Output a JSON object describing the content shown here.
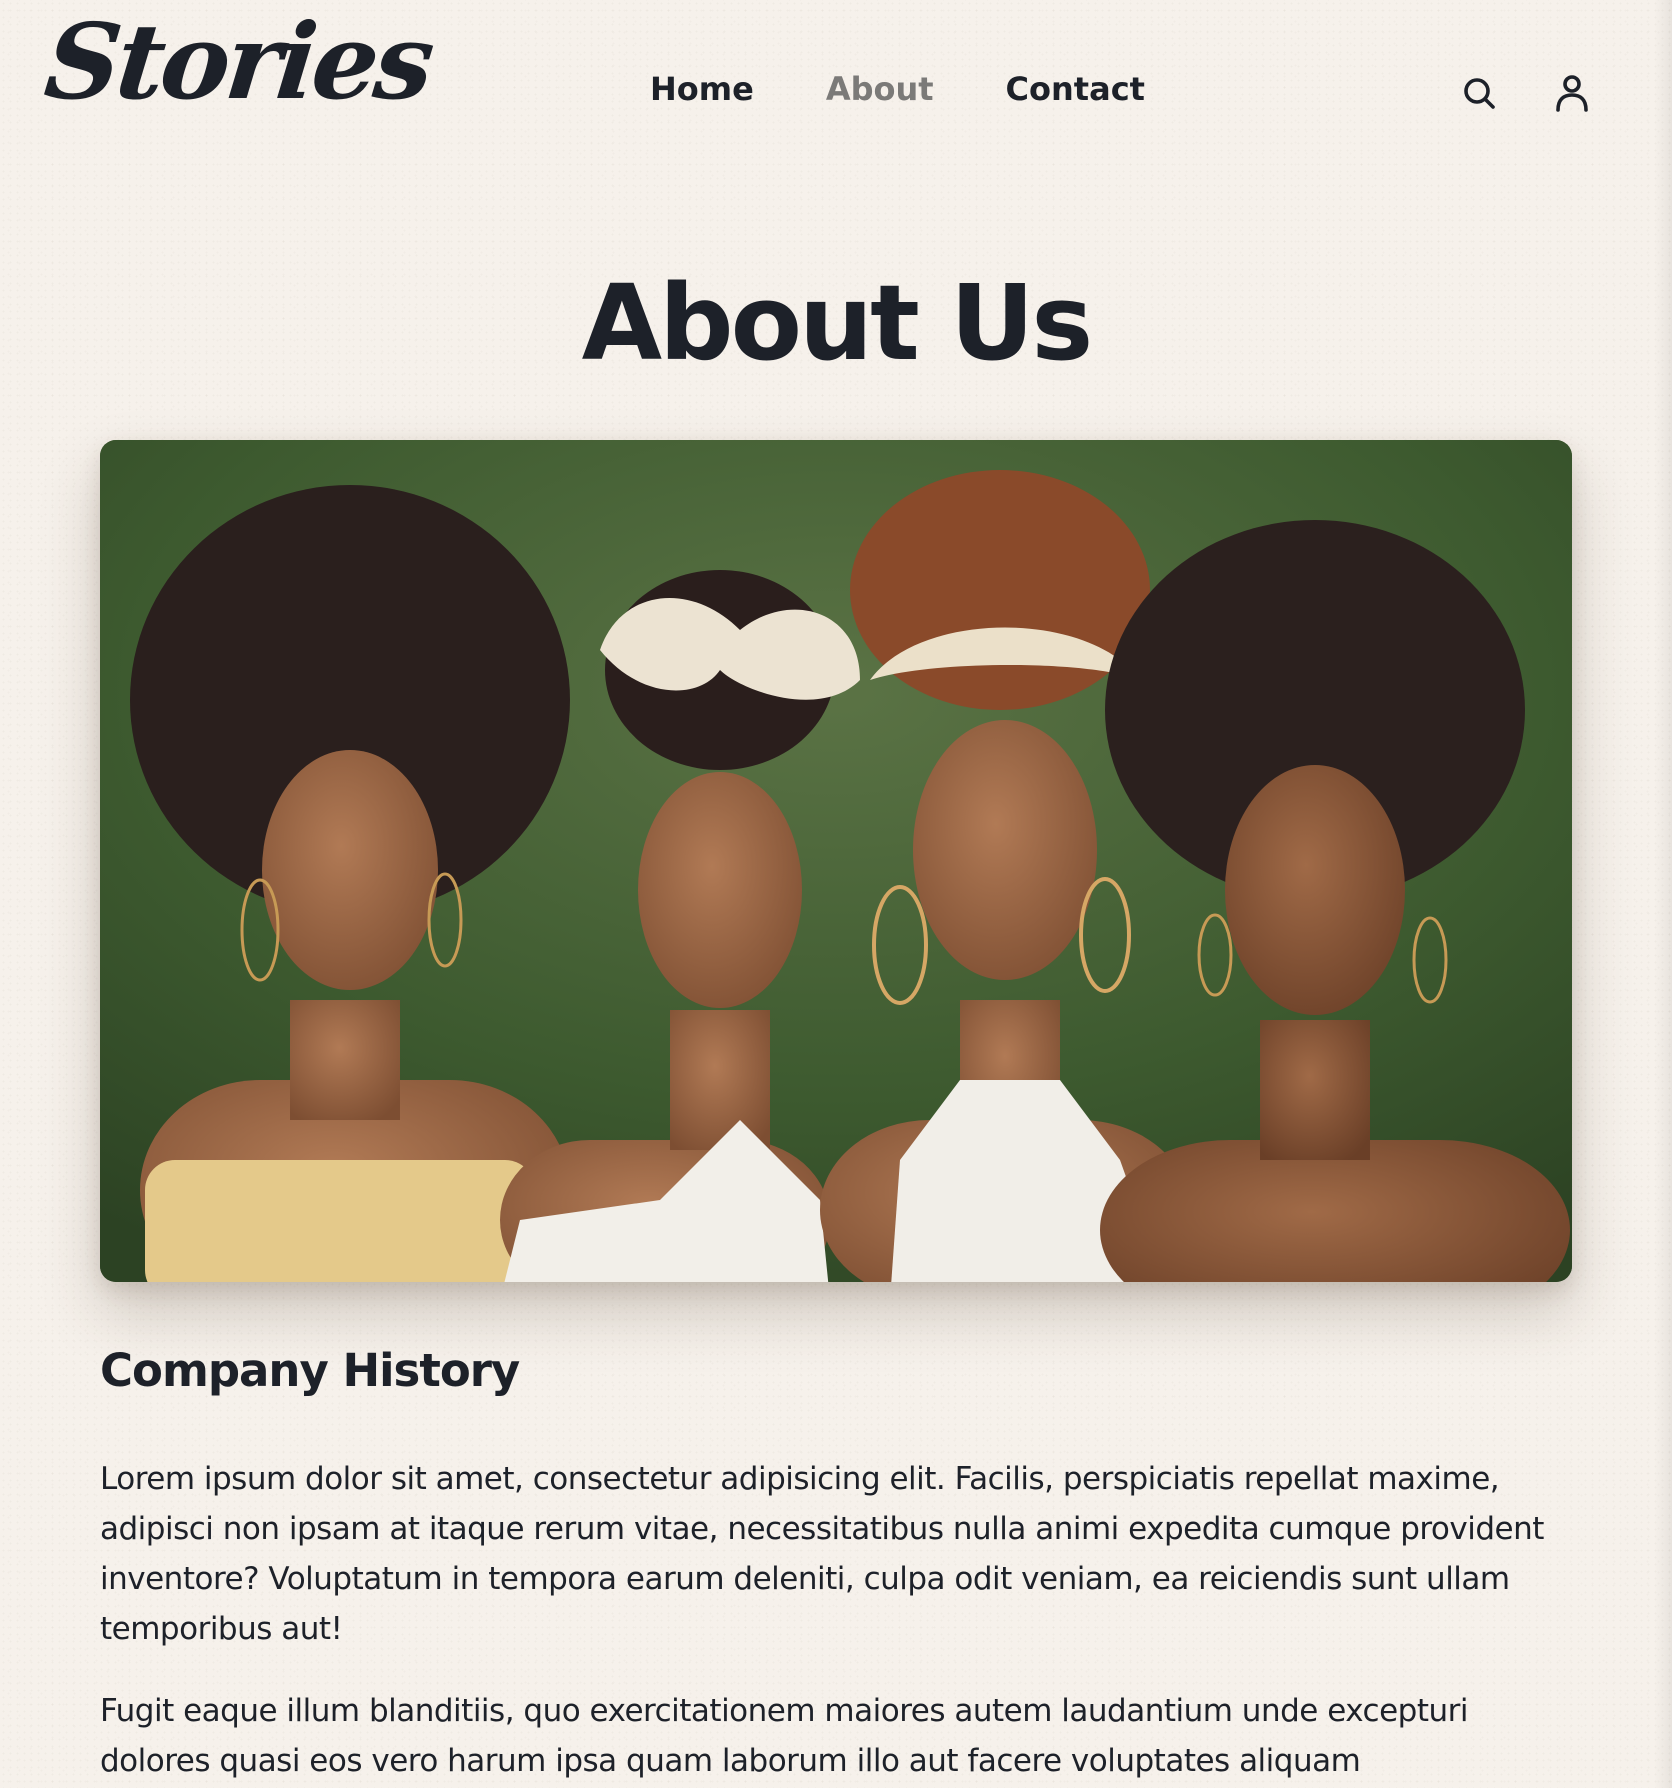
{
  "brand": {
    "logo_text": "Stories"
  },
  "nav": {
    "items": [
      {
        "label": "Home",
        "active": false
      },
      {
        "label": "About",
        "active": true
      },
      {
        "label": "Contact",
        "active": false
      }
    ],
    "icons": [
      "search-icon",
      "user-icon"
    ]
  },
  "page": {
    "title": "About Us"
  },
  "hero": {
    "image_subject": "four young women with natural afro hairstyles, outdoor green background"
  },
  "history": {
    "title": "Company History",
    "paragraphs": [
      "Lorem ipsum dolor sit amet, consectetur adipisicing elit. Facilis, perspiciatis repellat maxime, adipisci non ipsam at itaque rerum vitae, necessitatibus nulla animi expedita cumque provident inventore? Voluptatum in tempora earum deleniti, culpa odit veniam, ea reiciendis sunt ullam temporibus aut!",
      "Fugit eaque illum blanditiis, quo exercitationem maiores autem laudantium unde excepturi dolores quasi eos vero harum ipsa quam laborum illo aut facere voluptates aliquam"
    ]
  },
  "colors": {
    "background": "#f6f1eb",
    "text": "#1d2129",
    "nav_active": "#7b7a78"
  }
}
